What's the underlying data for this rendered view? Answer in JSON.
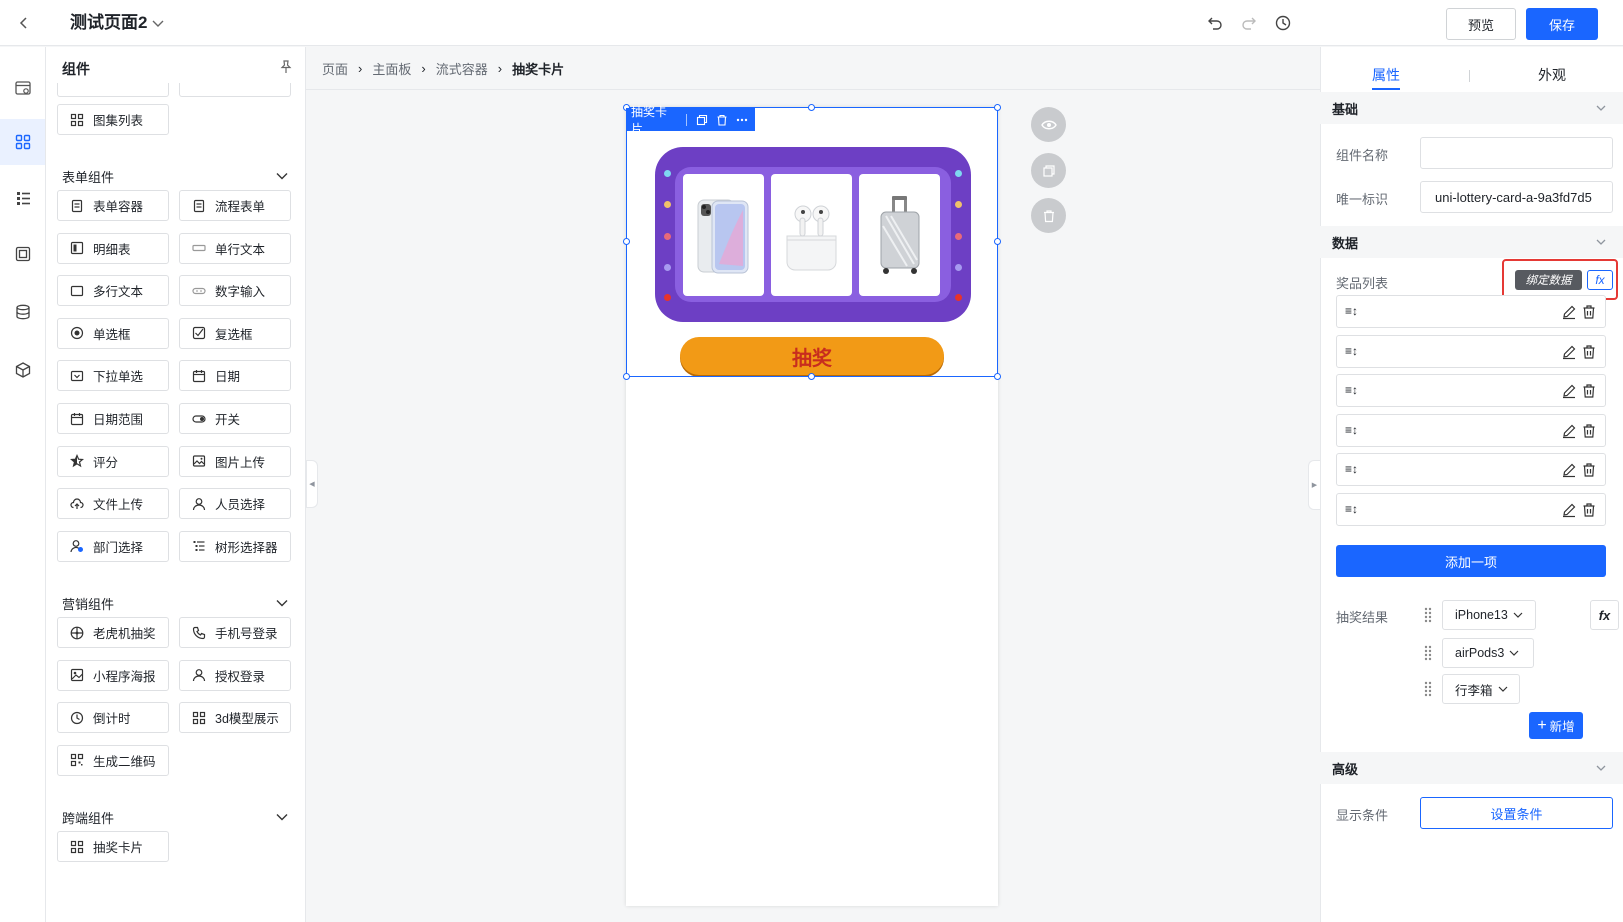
{
  "header": {
    "title": "测试页面2",
    "preview_label": "预览",
    "save_label": "保存"
  },
  "components_panel": {
    "title": "组件",
    "top_items": [
      "图集列表"
    ],
    "sections": [
      {
        "title": "表单组件",
        "items": [
          "表单容器",
          "流程表单",
          "明细表",
          "单行文本",
          "多行文本",
          "数字输入",
          "单选框",
          "复选框",
          "下拉单选",
          "日期",
          "日期范围",
          "开关",
          "评分",
          "图片上传",
          "文件上传",
          "人员选择",
          "部门选择",
          "树形选择器"
        ]
      },
      {
        "title": "营销组件",
        "items": [
          "老虎机抽奖",
          "手机号登录",
          "小程序海报",
          "授权登录",
          "倒计时",
          "3d模型展示",
          "生成二维码"
        ]
      },
      {
        "title": "跨端组件",
        "items": [
          "抽奖卡片"
        ]
      }
    ]
  },
  "breadcrumb": [
    "页面",
    "主面板",
    "流式容器",
    "抽奖卡片"
  ],
  "canvas": {
    "selected_label": "抽奖卡片",
    "draw_button": "抽奖",
    "colors": {
      "accent": "#1a66ff",
      "lottery_bg": "#6d3fc4",
      "draw_button": "#f29a16"
    }
  },
  "properties": {
    "tabs": [
      "属性",
      "外观"
    ],
    "active_tab": "属性",
    "basic": {
      "title": "基础",
      "name_label": "组件名称",
      "name_value": "",
      "id_label": "唯一标识",
      "id_value": "uni-lottery-card-a-9a3fd7d5"
    },
    "data": {
      "title": "数据",
      "prize_list_label": "奖品列表",
      "bind_label": "绑定数据",
      "fx_label": "fx",
      "add_item_label": "添加一项",
      "result_label": "抽奖结果",
      "results": [
        "iPhone13",
        "airPods3",
        "行李箱"
      ],
      "add_new_label": "新增"
    },
    "advanced": {
      "title": "高级",
      "condition_label": "显示条件",
      "set_condition_label": "设置条件"
    }
  }
}
